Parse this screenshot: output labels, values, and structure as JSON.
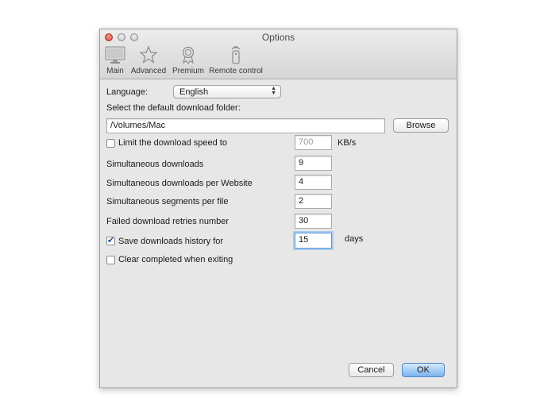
{
  "window": {
    "title": "Options"
  },
  "toolbar": {
    "items": [
      {
        "label": "Main",
        "icon": "monitor-icon"
      },
      {
        "label": "Advanced",
        "icon": "star-icon"
      },
      {
        "label": "Premium",
        "icon": "award-icon"
      },
      {
        "label": "Remote control",
        "icon": "remote-control-icon"
      }
    ]
  },
  "form": {
    "language_label": "Language:",
    "language_value": "English",
    "folder_label": "Select the default download folder:",
    "folder_value": "/Volumes/Mac",
    "browse_label": "Browse",
    "limit_speed_label": "Limit the download speed to",
    "limit_speed_checked": false,
    "speed_value": "700",
    "speed_unit": "KB/s",
    "simultaneous_label": "Simultaneous downloads",
    "simultaneous_value": "9",
    "per_website_label": "Simultaneous downloads per Website",
    "per_website_value": "4",
    "segments_label": "Simultaneous segments per file",
    "segments_value": "2",
    "retries_label": "Failed download retries number",
    "retries_value": "30",
    "history_label": "Save downloads history for",
    "history_checked": true,
    "history_value": "15",
    "history_unit": "days",
    "clear_label": "Clear completed when exiting",
    "clear_checked": false
  },
  "footer": {
    "cancel_label": "Cancel",
    "ok_label": "OK"
  },
  "colors": {
    "accent": "#79b4ef",
    "window_bg": "#e7e7e7"
  }
}
